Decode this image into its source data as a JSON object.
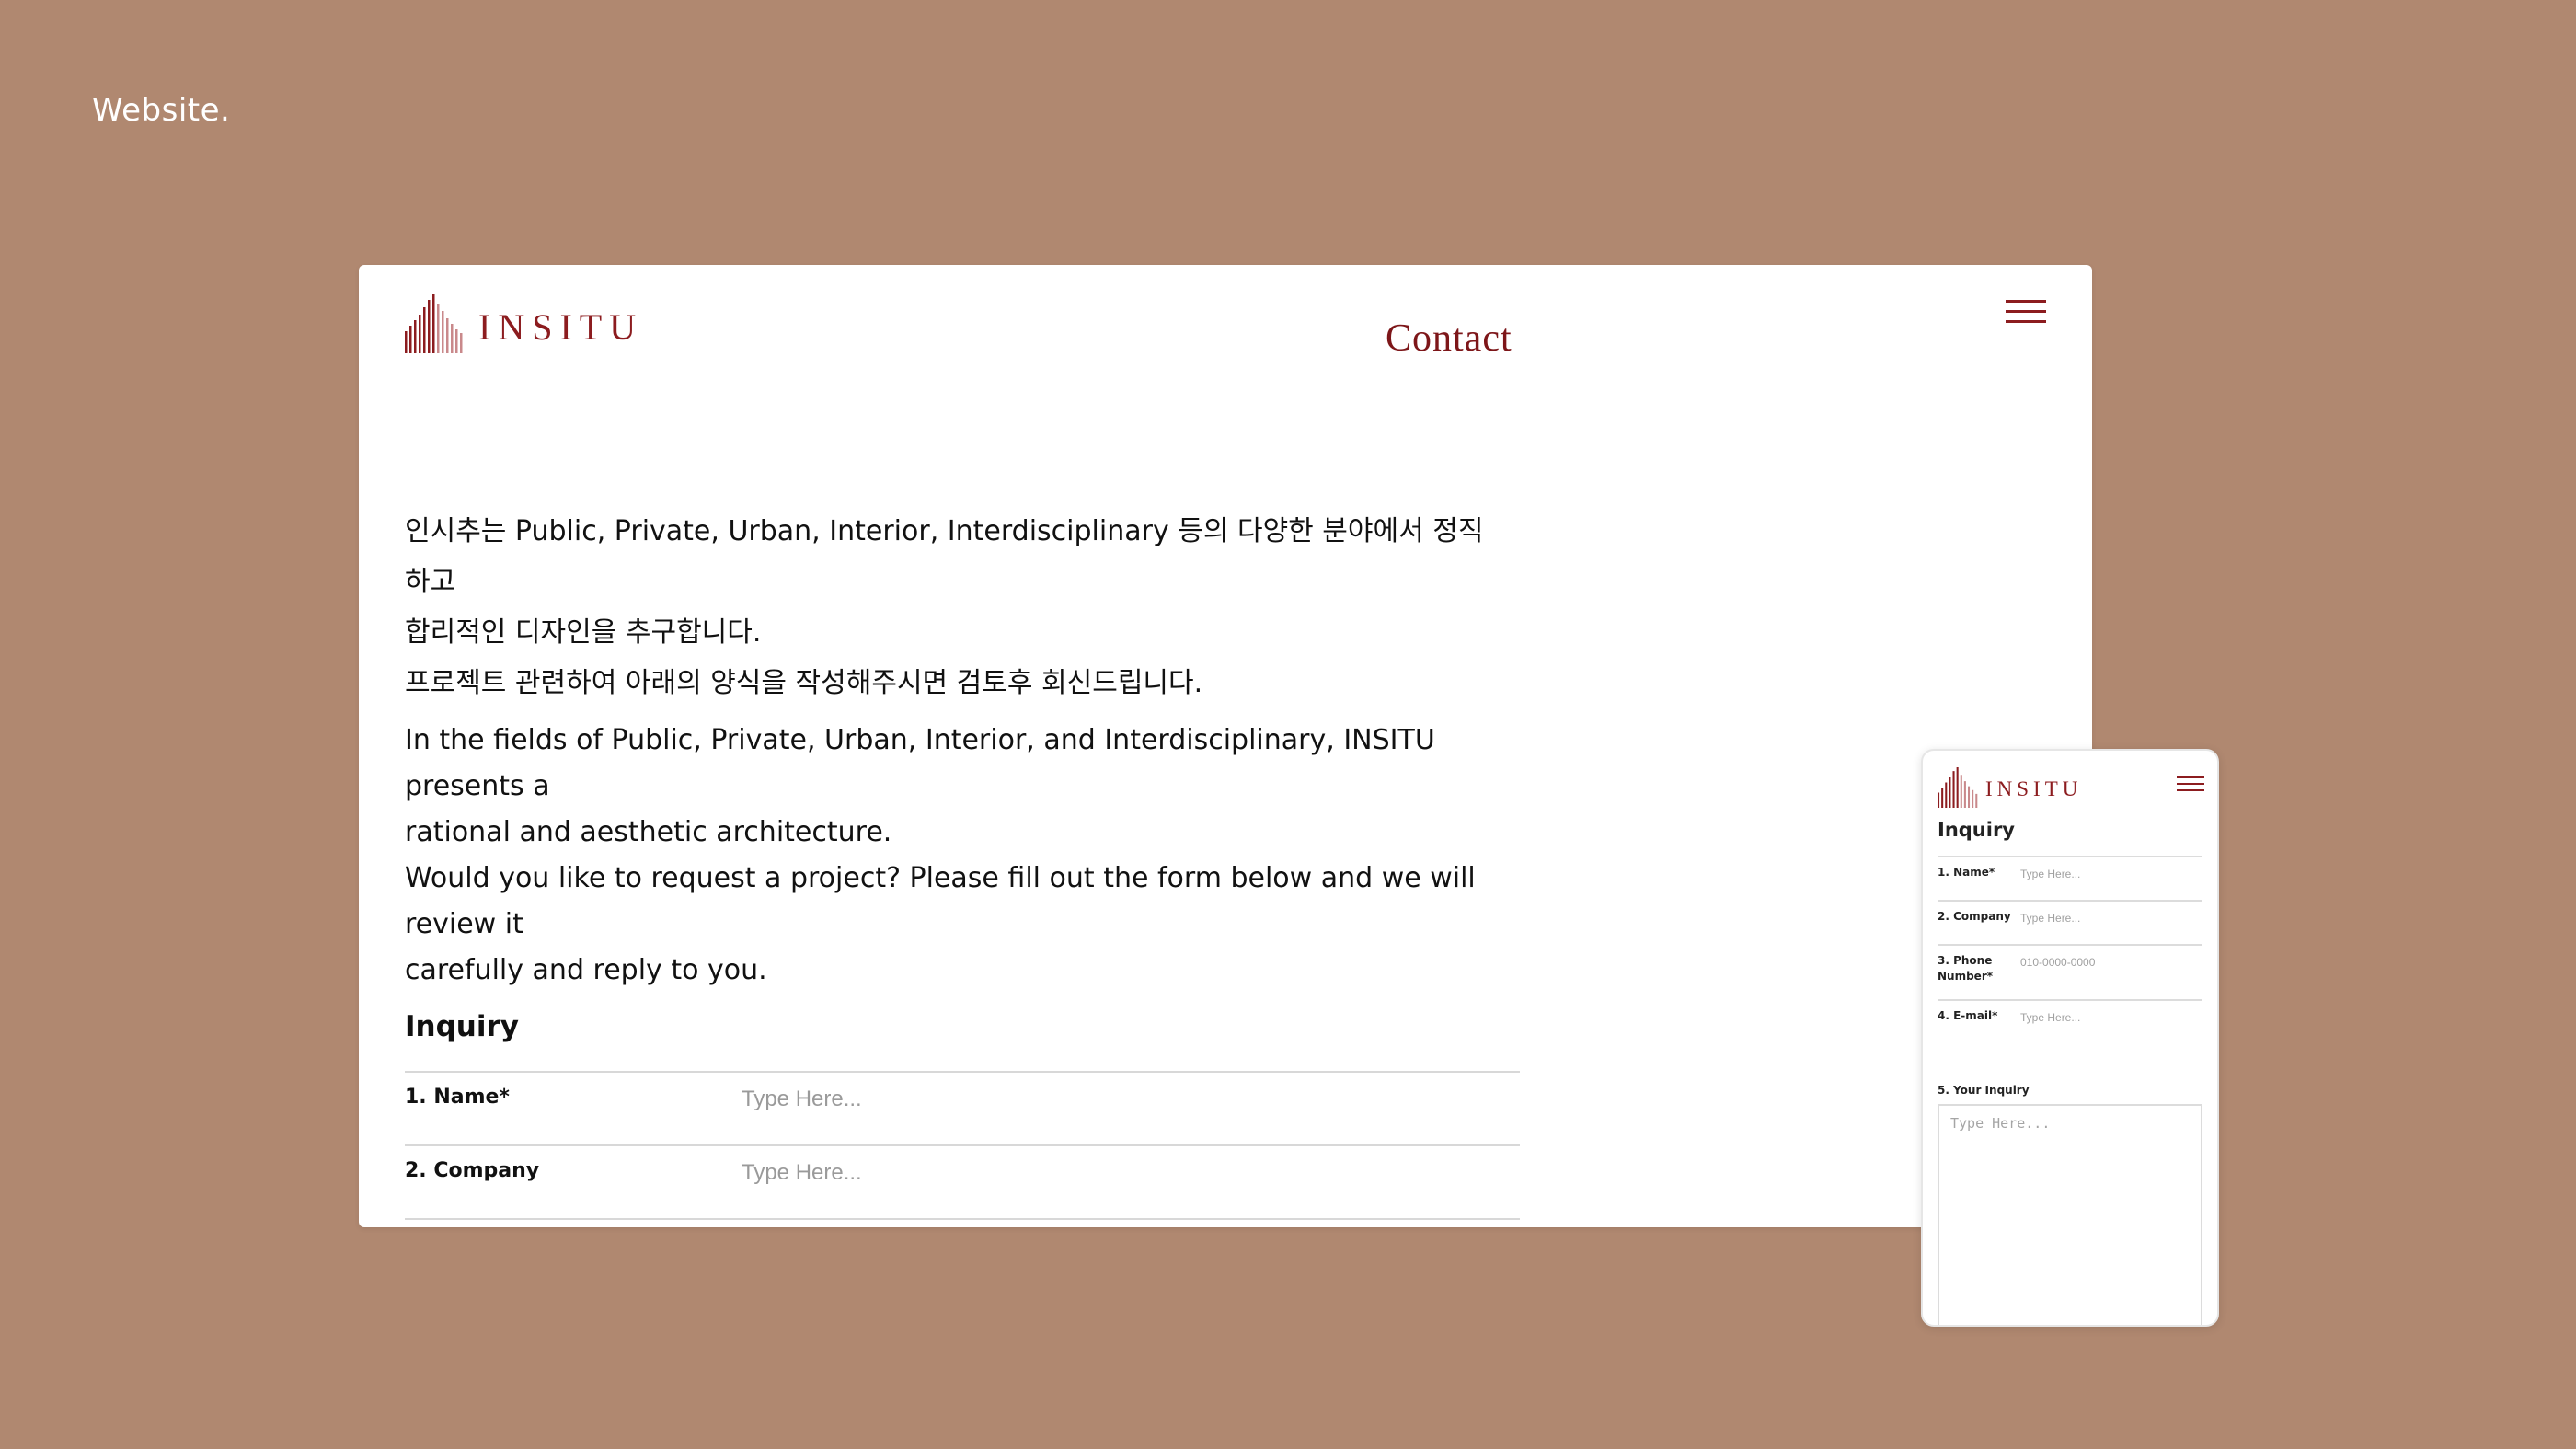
{
  "slide": {
    "label": "Website."
  },
  "brand": {
    "name": "INSITU",
    "color": "#8c1c1f"
  },
  "colors": {
    "background": "#b08870",
    "accent": "#8c1c1f"
  },
  "desktop": {
    "page_title": "Contact",
    "intro_ko": [
      "인시추는 Public, Private, Urban, Interior, Interdisciplinary 등의 다양한 분야에서 정직하고",
      "합리적인 디자인을 추구합니다.",
      "프로젝트 관련하여 아래의 양식을 작성해주시면 검토후 회신드립니다."
    ],
    "intro_en": [
      "In the fields of Public, Private, Urban, Interior, and Interdisciplinary, INSITU presents a",
      "rational and aesthetic architecture.",
      "Would you like to request a project? Please fill out the form below and we will review it",
      "carefully and reply to you."
    ],
    "inquiry_title": "Inquiry",
    "fields": [
      {
        "label": "1. Name*",
        "placeholder": "Type Here..."
      },
      {
        "label": "2. Company",
        "placeholder": "Type Here..."
      }
    ],
    "menu_icon": "hamburger-menu-icon"
  },
  "mobile": {
    "title": "Inquiry",
    "fields": [
      {
        "label": "1. Name*",
        "placeholder": "Type Here..."
      },
      {
        "label": "2. Company",
        "placeholder": "Type Here..."
      },
      {
        "label": "3. Phone Number*",
        "placeholder": "010-0000-0000"
      },
      {
        "label": "4. E-mail*",
        "placeholder": "Type Here..."
      }
    ],
    "inquiry_label": "5. Your Inquiry",
    "inquiry_placeholder": "Type Here...",
    "menu_icon": "hamburger-menu-icon"
  }
}
